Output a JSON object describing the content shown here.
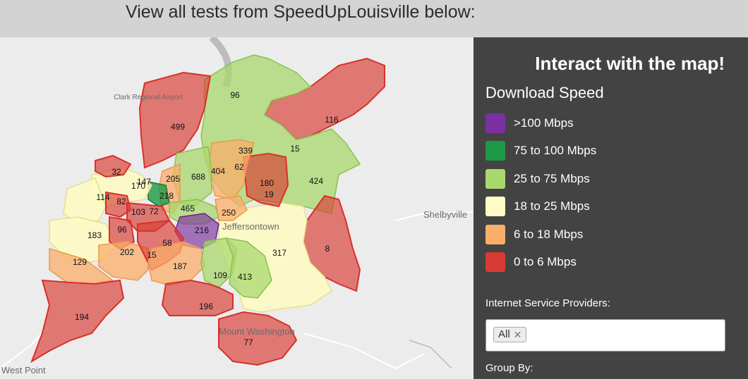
{
  "header": {
    "title": "View all tests from SpeedUpLouisville below:"
  },
  "panel": {
    "title": "Interact with the map!",
    "legend_title": "Download Speed",
    "legend": [
      {
        "label": ">100 Mbps",
        "color": "#7b2fa0"
      },
      {
        "label": "75 to 100 Mbps",
        "color": "#1e9a46"
      },
      {
        "label": "25 to 75 Mbps",
        "color": "#a8d86e"
      },
      {
        "label": "18 to 25 Mbps",
        "color": "#fffbc2"
      },
      {
        "label": "6 to 18 Mbps",
        "color": "#fbae69"
      },
      {
        "label": "0 to 6 Mbps",
        "color": "#d83b33"
      }
    ],
    "isp_label": "Internet Service Providers:",
    "isp_selected": "All",
    "group_label": "Group By:"
  },
  "map": {
    "places": {
      "airport": "Clark Regional Airport",
      "shelbyville": "Shelbyville",
      "jeffersontown": "Jeffersontown",
      "mount_washington": "Mount Washington",
      "west_point": "West Point"
    },
    "region_counts": {
      "c499": "499",
      "c96a": "96",
      "c116": "116",
      "c15a": "15",
      "c339": "339",
      "c62": "62",
      "c404": "404",
      "c688": "688",
      "c205": "205",
      "c147": "147",
      "c170": "170",
      "c32": "32",
      "c114": "114",
      "c82": "82",
      "c218": "218",
      "c465": "465",
      "c180": "180",
      "c19": "19",
      "c424": "424",
      "c103": "103",
      "c72": "72",
      "c96b": "96",
      "c250": "250",
      "c216": "216",
      "c183": "183",
      "c202": "202",
      "c15b": "15",
      "c58": "58",
      "c317": "317",
      "c8": "8",
      "c129": "129",
      "c187": "187",
      "c109": "109",
      "c413": "413",
      "c194": "194",
      "c196": "196",
      "c77": "77"
    }
  }
}
